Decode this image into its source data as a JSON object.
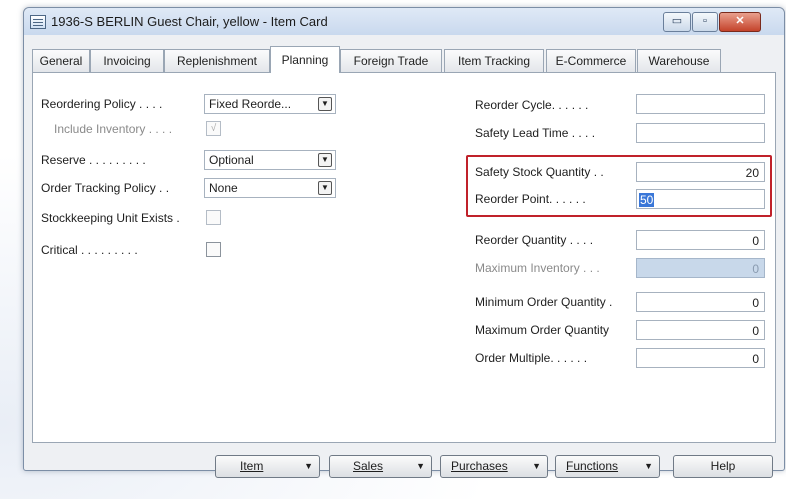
{
  "window": {
    "title": "1936-S BERLIN Guest Chair, yellow - Item Card",
    "controls": {
      "minimize": "▭",
      "maximize": "▫",
      "close": "✕"
    }
  },
  "tabs": [
    "General",
    "Invoicing",
    "Replenishment",
    "Planning",
    "Foreign Trade",
    "Item Tracking",
    "E-Commerce",
    "Warehouse"
  ],
  "active_tab": "Planning",
  "left": {
    "reordering_policy": {
      "label": "Reordering Policy . . . .",
      "value": "Fixed Reorde..."
    },
    "include_inventory": {
      "label": "Include Inventory . . . .",
      "checked": true,
      "check_glyph": "√"
    },
    "reserve": {
      "label": "Reserve . . . . . . . . .",
      "value": "Optional"
    },
    "order_tracking_policy": {
      "label": "Order Tracking Policy . .",
      "value": "None"
    },
    "stockkeeping_unit_exists": {
      "label": "Stockkeeping Unit Exists .",
      "checked": false
    },
    "critical": {
      "label": "Critical . . . . . . . . .",
      "checked": false
    }
  },
  "right": {
    "reorder_cycle": {
      "label": "Reorder Cycle. . . . . .",
      "value": ""
    },
    "safety_lead_time": {
      "label": "Safety Lead Time . . . .",
      "value": ""
    },
    "safety_stock_quantity": {
      "label": "Safety Stock Quantity . .",
      "value": "20"
    },
    "reorder_point": {
      "label": "Reorder Point. . . . . .",
      "value": "50"
    },
    "reorder_quantity": {
      "label": "Reorder Quantity . . . .",
      "value": "0"
    },
    "maximum_inventory": {
      "label": "Maximum Inventory . . .",
      "value": "0"
    },
    "minimum_order_quantity": {
      "label": "Minimum Order Quantity .",
      "value": "0"
    },
    "maximum_order_quantity": {
      "label": "Maximum Order Quantity",
      "value": "0"
    },
    "order_multiple": {
      "label": "Order Multiple. . . . . .",
      "value": "0"
    }
  },
  "buttons": {
    "item": "Item",
    "sales": "Sales",
    "purchases": "Purchases",
    "functions": "Functions",
    "help": "Help",
    "dropdown_glyph": "▼"
  },
  "dropdown_glyph": "▼",
  "colors": {
    "highlight": "#c0212a",
    "selection": "#3a77d8"
  }
}
